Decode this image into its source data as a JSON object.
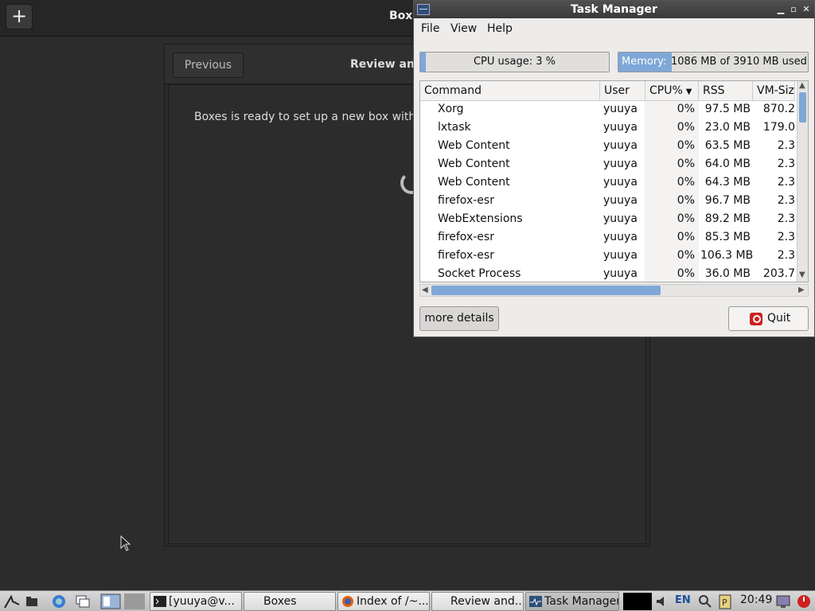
{
  "boxes": {
    "header_title": "Box",
    "new_button": "+",
    "previous_label": "Previous",
    "wizard_title": "Review an",
    "message": "Boxes is ready to set up a new box with th"
  },
  "task_manager": {
    "title": "Task Manager",
    "menu": {
      "file": "File",
      "view": "View",
      "help": "Help"
    },
    "cpu_usage": {
      "label": "CPU usage: 3 %",
      "fraction": 0.03
    },
    "memory": {
      "label": "Memory:",
      "value": "1086 MB of 3910 MB used",
      "fraction": 0.28
    },
    "columns": {
      "command": "Command",
      "user": "User",
      "cpu": "CPU%",
      "rss": "RSS",
      "vm": "VM-Siz"
    },
    "processes": [
      {
        "command": "Xorg",
        "user": "yuuya",
        "cpu": "0%",
        "rss": "97.5 MB",
        "vm": "870.2"
      },
      {
        "command": "lxtask",
        "user": "yuuya",
        "cpu": "0%",
        "rss": "23.0 MB",
        "vm": "179.0"
      },
      {
        "command": "Web Content",
        "user": "yuuya",
        "cpu": "0%",
        "rss": "63.5 MB",
        "vm": "2.3"
      },
      {
        "command": "Web Content",
        "user": "yuuya",
        "cpu": "0%",
        "rss": "64.0 MB",
        "vm": "2.3"
      },
      {
        "command": "Web Content",
        "user": "yuuya",
        "cpu": "0%",
        "rss": "64.3 MB",
        "vm": "2.3"
      },
      {
        "command": "firefox-esr",
        "user": "yuuya",
        "cpu": "0%",
        "rss": "96.7 MB",
        "vm": "2.3"
      },
      {
        "command": "WebExtensions",
        "user": "yuuya",
        "cpu": "0%",
        "rss": "89.2 MB",
        "vm": "2.3"
      },
      {
        "command": "firefox-esr",
        "user": "yuuya",
        "cpu": "0%",
        "rss": "85.3 MB",
        "vm": "2.3"
      },
      {
        "command": "firefox-esr",
        "user": "yuuya",
        "cpu": "0%",
        "rss": "106.3 MB",
        "vm": "2.3"
      },
      {
        "command": "Socket Process",
        "user": "yuuya",
        "cpu": "0%",
        "rss": "36.0 MB",
        "vm": "203.7"
      }
    ],
    "more_details": "more details",
    "quit": "Quit"
  },
  "taskbar": {
    "tasks": [
      {
        "label": "[yuuya@v...",
        "icon": "terminal-icon"
      },
      {
        "label": "Boxes",
        "icon": ""
      },
      {
        "label": "Index of /~...",
        "icon": "firefox-icon"
      },
      {
        "label": "Review and...",
        "icon": ""
      },
      {
        "label": "Task Manager",
        "icon": "task-manager-icon"
      }
    ],
    "language": "EN",
    "clock": "20:49"
  }
}
